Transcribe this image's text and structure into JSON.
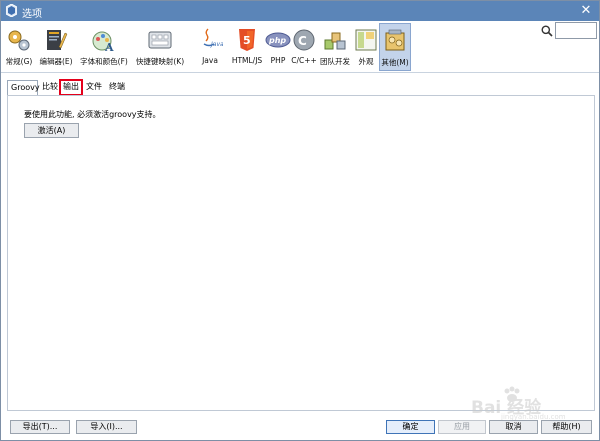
{
  "window": {
    "title": "选项",
    "close_glyph": "✕"
  },
  "toolbar": {
    "categories": [
      {
        "label": "常规(G)",
        "icon": "gears-icon"
      },
      {
        "label": "编辑器(E)",
        "icon": "editor-icon"
      },
      {
        "label": "字体和颜色(F)",
        "icon": "fonts-colors-icon"
      },
      {
        "label": "快捷键映射(K)",
        "icon": "keyboard-icon"
      },
      {
        "label": "Java",
        "icon": "java-icon"
      },
      {
        "label": "HTML/JS",
        "icon": "html5-icon"
      },
      {
        "label": "PHP",
        "icon": "php-icon"
      },
      {
        "label": "C/C++",
        "icon": "cpp-icon"
      },
      {
        "label": "团队开发",
        "icon": "team-icon"
      },
      {
        "label": "外观",
        "icon": "appearance-icon"
      },
      {
        "label": "其他(M)",
        "icon": "misc-icon",
        "selected": true
      }
    ],
    "search": {
      "value": "",
      "placeholder": ""
    }
  },
  "tabs": [
    {
      "label": "Groovy",
      "active": true
    },
    {
      "label": "比较"
    },
    {
      "label": "输出",
      "highlighted": true
    },
    {
      "label": "文件"
    },
    {
      "label": "终端"
    }
  ],
  "content": {
    "message": "要使用此功能, 必须激活groovy支持。",
    "activate_label": "激活(A)"
  },
  "footer": {
    "export_label": "导出(T)...",
    "import_label": "导入(I)...",
    "ok_label": "确定",
    "apply_label": "应用",
    "cancel_label": "取消",
    "help_label": "帮助(H)"
  },
  "watermark": {
    "text": "Bai 经验",
    "url": "jingyan.baidu.com"
  },
  "colors": {
    "titlebar": "#5b85b8",
    "selected_category": "#c3d3ea",
    "highlight_box": "#e4001b"
  }
}
